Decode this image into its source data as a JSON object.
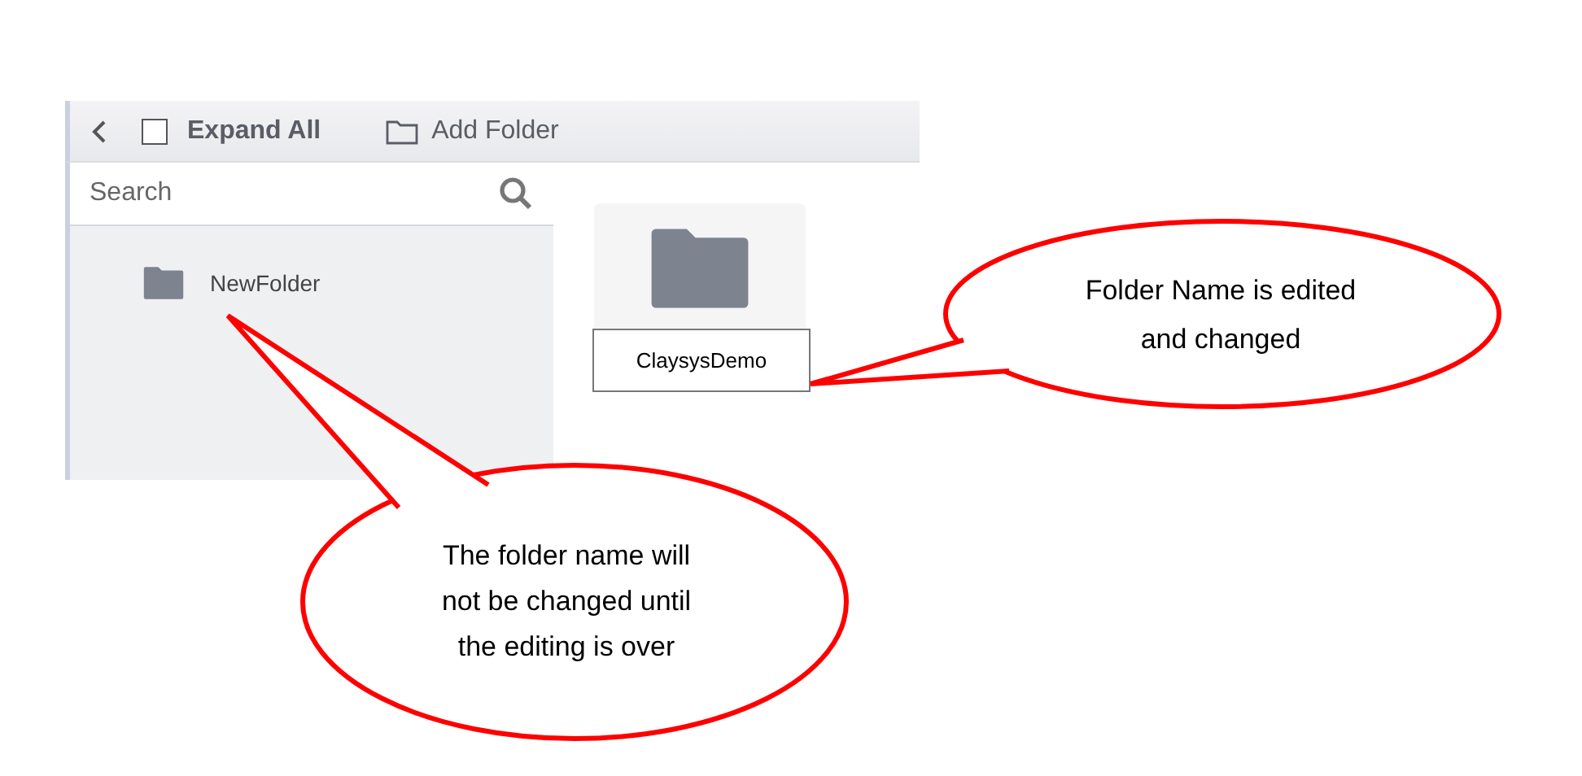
{
  "toolbar": {
    "expand_all": {
      "label": "Expand All",
      "checked": false
    },
    "add_folder": {
      "label": "Add Folder"
    }
  },
  "sidebar": {
    "search": {
      "placeholder": "Search"
    },
    "tree": [
      {
        "label": "NewFolder"
      }
    ]
  },
  "content": {
    "folders": [
      {
        "name": "ClaysysDemo",
        "editing": true
      }
    ]
  },
  "callouts": [
    {
      "text": "Folder Name is edited and changed"
    },
    {
      "text": "The folder name will not be changed until the editing is over"
    }
  ]
}
